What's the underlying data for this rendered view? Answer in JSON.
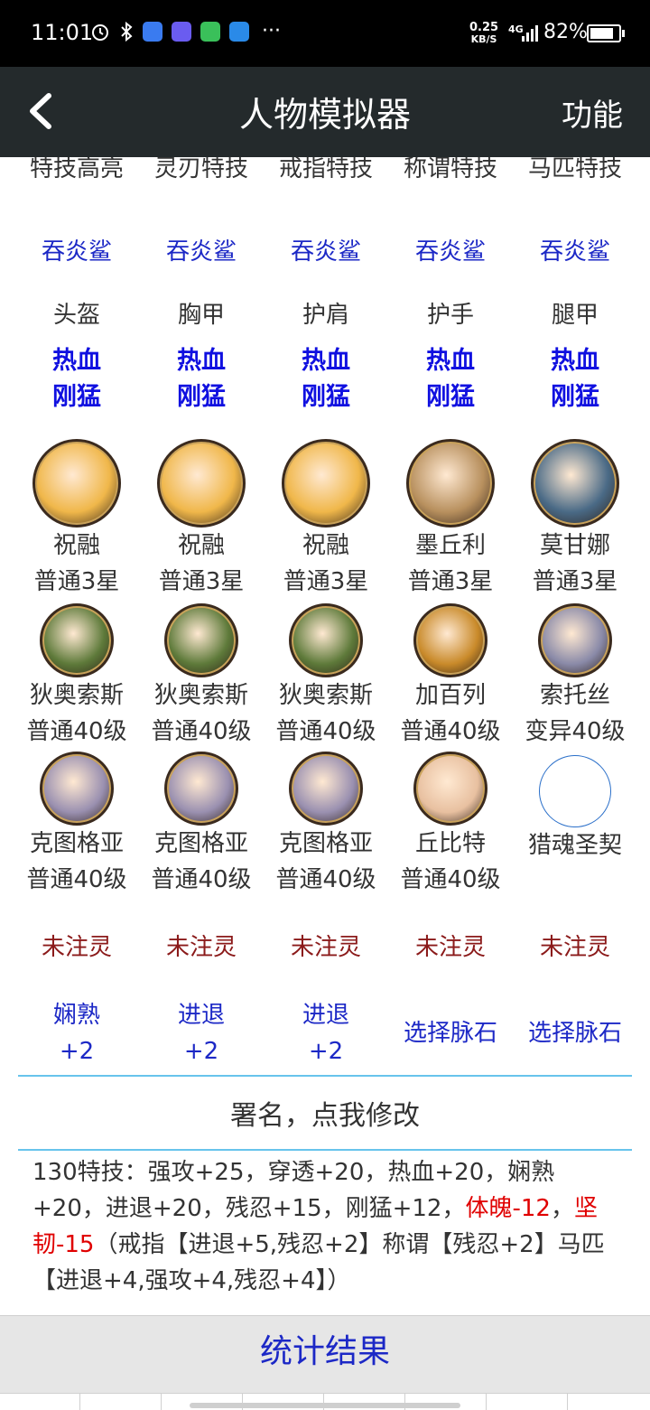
{
  "status_bar": {
    "time": "11:01",
    "speed_value": "0.25",
    "speed_unit": "KB/S",
    "network": "4G",
    "battery_percent": "82%",
    "battery_level": 0.82,
    "more_glyph": "···",
    "icons": [
      "alarm-icon",
      "bluetooth-icon",
      "app-blue-icon",
      "app-purple-icon",
      "wechat-icon",
      "app-feather-icon"
    ]
  },
  "nav": {
    "back_glyph": "<",
    "title": "人物模拟器",
    "function_label": "功能"
  },
  "skills_header": [
    "特技高亮",
    "灵刃特技",
    "戒指特技",
    "称谓特技",
    "马匹特技"
  ],
  "skill_values": [
    "吞炎鲨",
    "吞炎鲨",
    "吞炎鲨",
    "吞炎鲨",
    "吞炎鲨"
  ],
  "equipment_slots": [
    "头盔",
    "胸甲",
    "护肩",
    "护手",
    "腿甲"
  ],
  "equipment_traits": [
    {
      "line1": "热血",
      "line2": "刚猛"
    },
    {
      "line1": "热血",
      "line2": "刚猛"
    },
    {
      "line1": "热血",
      "line2": "刚猛"
    },
    {
      "line1": "热血",
      "line2": "刚猛"
    },
    {
      "line1": "热血",
      "line2": "刚猛"
    }
  ],
  "pets_row1": [
    {
      "name": "祝融",
      "level": "普通3星",
      "color": "#f0b74a"
    },
    {
      "name": "祝融",
      "level": "普通3星",
      "color": "#f0b74a"
    },
    {
      "name": "祝融",
      "level": "普通3星",
      "color": "#f0b74a"
    },
    {
      "name": "墨丘利",
      "level": "普通3星",
      "color": "#b8905e"
    },
    {
      "name": "莫甘娜",
      "level": "普通3星",
      "color": "#4a6a86"
    }
  ],
  "pets_row2": [
    {
      "name": "狄奥索斯",
      "level": "普通40级",
      "color": "#5e7a3a"
    },
    {
      "name": "狄奥索斯",
      "level": "普通40级",
      "color": "#5e7a3a"
    },
    {
      "name": "狄奥索斯",
      "level": "普通40级",
      "color": "#5e7a3a"
    },
    {
      "name": "加百列",
      "level": "普通40级",
      "color": "#c98a2a"
    },
    {
      "name": "索托丝",
      "level": "变异40级",
      "color": "#8a8aa8"
    }
  ],
  "pets_row3": [
    {
      "name": "克图格亚",
      "level": "普通40级",
      "color": "#9a90b0"
    },
    {
      "name": "克图格亚",
      "level": "普通40级",
      "color": "#9a90b0"
    },
    {
      "name": "克图格亚",
      "level": "普通40级",
      "color": "#9a90b0"
    }
  ],
  "pet_row3_extra": {
    "name": "丘比特",
    "level": "普通40级",
    "color": "#e8c0a0"
  },
  "soul_contract": "猎魂圣契",
  "infusion_status": [
    "未注灵",
    "未注灵",
    "未注灵",
    "未注灵",
    "未注灵"
  ],
  "vein_stones": [
    {
      "line1": "娴熟",
      "line2": "+2"
    },
    {
      "line1": "进退",
      "line2": "+2"
    },
    {
      "line1": "进退",
      "line2": "+2"
    },
    {
      "line1": "选择脉石",
      "line2": ""
    },
    {
      "line1": "选择脉石",
      "line2": ""
    }
  ],
  "signature": "署名，点我修改",
  "summary": {
    "part1": "130特技：强攻+25，穿透+20，热血+20，娴熟+20，进退+20，残忍+15，刚猛+12，",
    "red1": "体魄-12",
    "sep": "，",
    "red2": "坚韧-15",
    "part2": "（戒指【进退+5,残忍+2】称谓【残忍+2】马匹【进退+4,强攻+4,残忍+4】）"
  },
  "result_button": "统计结果",
  "colors": {
    "nav_bg": "#242a2c",
    "link_blue": "#1c28c6",
    "warn_red": "#e00000",
    "divider": "#67c4ec"
  }
}
